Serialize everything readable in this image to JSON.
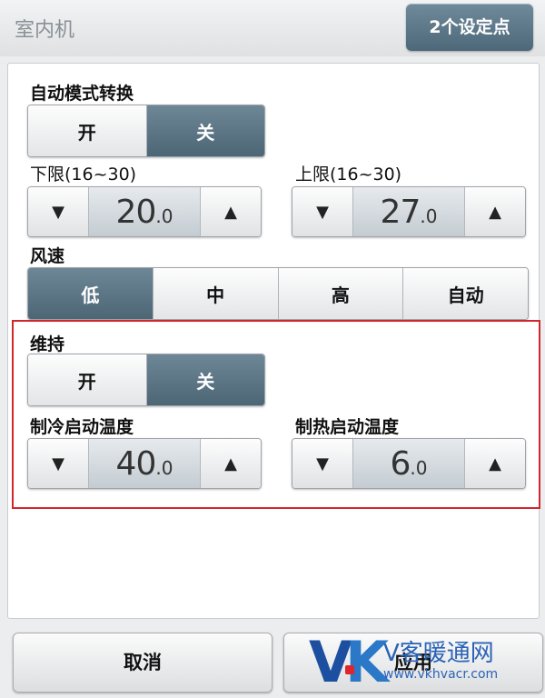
{
  "header": {
    "title": "室内机",
    "setpoints_button": "2个设定点"
  },
  "auto_mode": {
    "label": "自动模式转换",
    "on": "开",
    "off": "关",
    "selected": "关"
  },
  "lower_limit": {
    "label": "下限(16~30)",
    "value_int": "20",
    "value_dec": ".0"
  },
  "upper_limit": {
    "label": "上限(16~30)",
    "value_int": "27",
    "value_dec": ".0"
  },
  "fan_speed": {
    "label": "风速",
    "options": [
      "低",
      "中",
      "高",
      "自动"
    ],
    "selected": "低"
  },
  "maintain": {
    "label": "维持",
    "on": "开",
    "off": "关",
    "selected": "关"
  },
  "cooling_start": {
    "label": "制冷启动温度",
    "value_int": "40",
    "value_dec": ".0"
  },
  "heating_start": {
    "label": "制热启动温度",
    "value_int": "6",
    "value_dec": ".0"
  },
  "footer": {
    "cancel": "取消",
    "apply": "应用"
  },
  "icons": {
    "down": "triangle-down",
    "up": "triangle-up"
  },
  "colors": {
    "active": "#5a7585",
    "highlight_border": "#d0262d"
  },
  "watermark": {
    "logo_v": "V",
    "logo_k": "K",
    "name": "V客暖通网",
    "url": "www.vkhvacr.com"
  }
}
